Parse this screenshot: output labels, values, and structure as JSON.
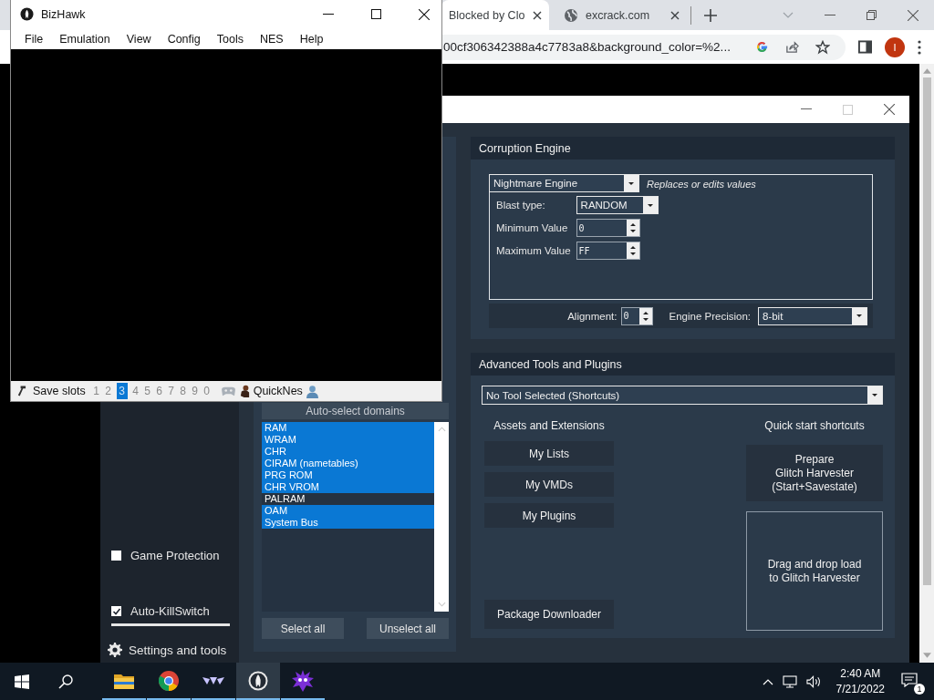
{
  "browser": {
    "tabs": [
      {
        "label": "Blocked by Clo",
        "selected": true
      },
      {
        "label": "excrack.com",
        "selected": false
      }
    ],
    "address": "00cf306342388a4c7783a8&background_color=%2...",
    "profile": "I"
  },
  "bizhawk": {
    "title": "BizHawk",
    "menu": [
      "File",
      "Emulation",
      "View",
      "Config",
      "Tools",
      "NES",
      "Help"
    ],
    "save_slots_label": "Save slots",
    "slots": [
      {
        "label": "1",
        "selected": false
      },
      {
        "label": "2",
        "selected": false
      },
      {
        "label": "3",
        "selected": true
      },
      {
        "label": "4",
        "selected": false
      },
      {
        "label": "5",
        "selected": false
      },
      {
        "label": "6",
        "selected": false
      },
      {
        "label": "7",
        "selected": false
      },
      {
        "label": "8",
        "selected": false
      },
      {
        "label": "9",
        "selected": false
      },
      {
        "label": "0",
        "selected": false
      }
    ],
    "core": "QuickNes"
  },
  "rtc": {
    "sidebar": {
      "options": [
        {
          "label": "Game Protection",
          "checked": false
        },
        {
          "label": "Auto-KillSwitch",
          "checked": true
        }
      ],
      "settings": "Settings and tools"
    },
    "domains": {
      "auto_select": "Auto-select domains",
      "items": [
        {
          "label": "RAM",
          "selected": true
        },
        {
          "label": "WRAM",
          "selected": true
        },
        {
          "label": "CHR",
          "selected": true
        },
        {
          "label": "CIRAM (nametables)",
          "selected": true
        },
        {
          "label": "PRG ROM",
          "selected": true
        },
        {
          "label": "CHR VROM",
          "selected": true
        },
        {
          "label": "PALRAM",
          "selected": false
        },
        {
          "label": "OAM",
          "selected": true
        },
        {
          "label": "System Bus",
          "selected": true
        }
      ],
      "buttons": [
        "Select all",
        "Unselect all"
      ]
    },
    "corruption_engine": {
      "title": "Corruption Engine",
      "engine": "Nightmare Engine",
      "description": "Replaces or edits values",
      "blast_type_label": "Blast type:",
      "blast_type": "RANDOM",
      "min_label": "Minimum Value",
      "min": "0",
      "max_label": "Maximum Value",
      "max": "FF",
      "alignment_label": "Alignment:",
      "alignment": "0",
      "precision_label": "Engine Precision:",
      "precision": "8-bit"
    },
    "advanced_tools": {
      "title": "Advanced Tools and Plugins",
      "tool": "No Tool Selected (Shortcuts)",
      "assets_title": "Assets and Extensions",
      "assets_buttons": [
        "My Lists",
        "My VMDs",
        "My Plugins"
      ],
      "package_button": "Package Downloader",
      "shortcuts_title": "Quick start shortcuts",
      "prepare_button": "Prepare\nGlitch Harvester\n(Start+Savestate)",
      "drop_zone": "Drag and drop load\nto Glitch Harvester"
    }
  },
  "taskbar": {
    "time": "2:40 AM",
    "date": "7/21/2022",
    "notifications": "1"
  }
}
